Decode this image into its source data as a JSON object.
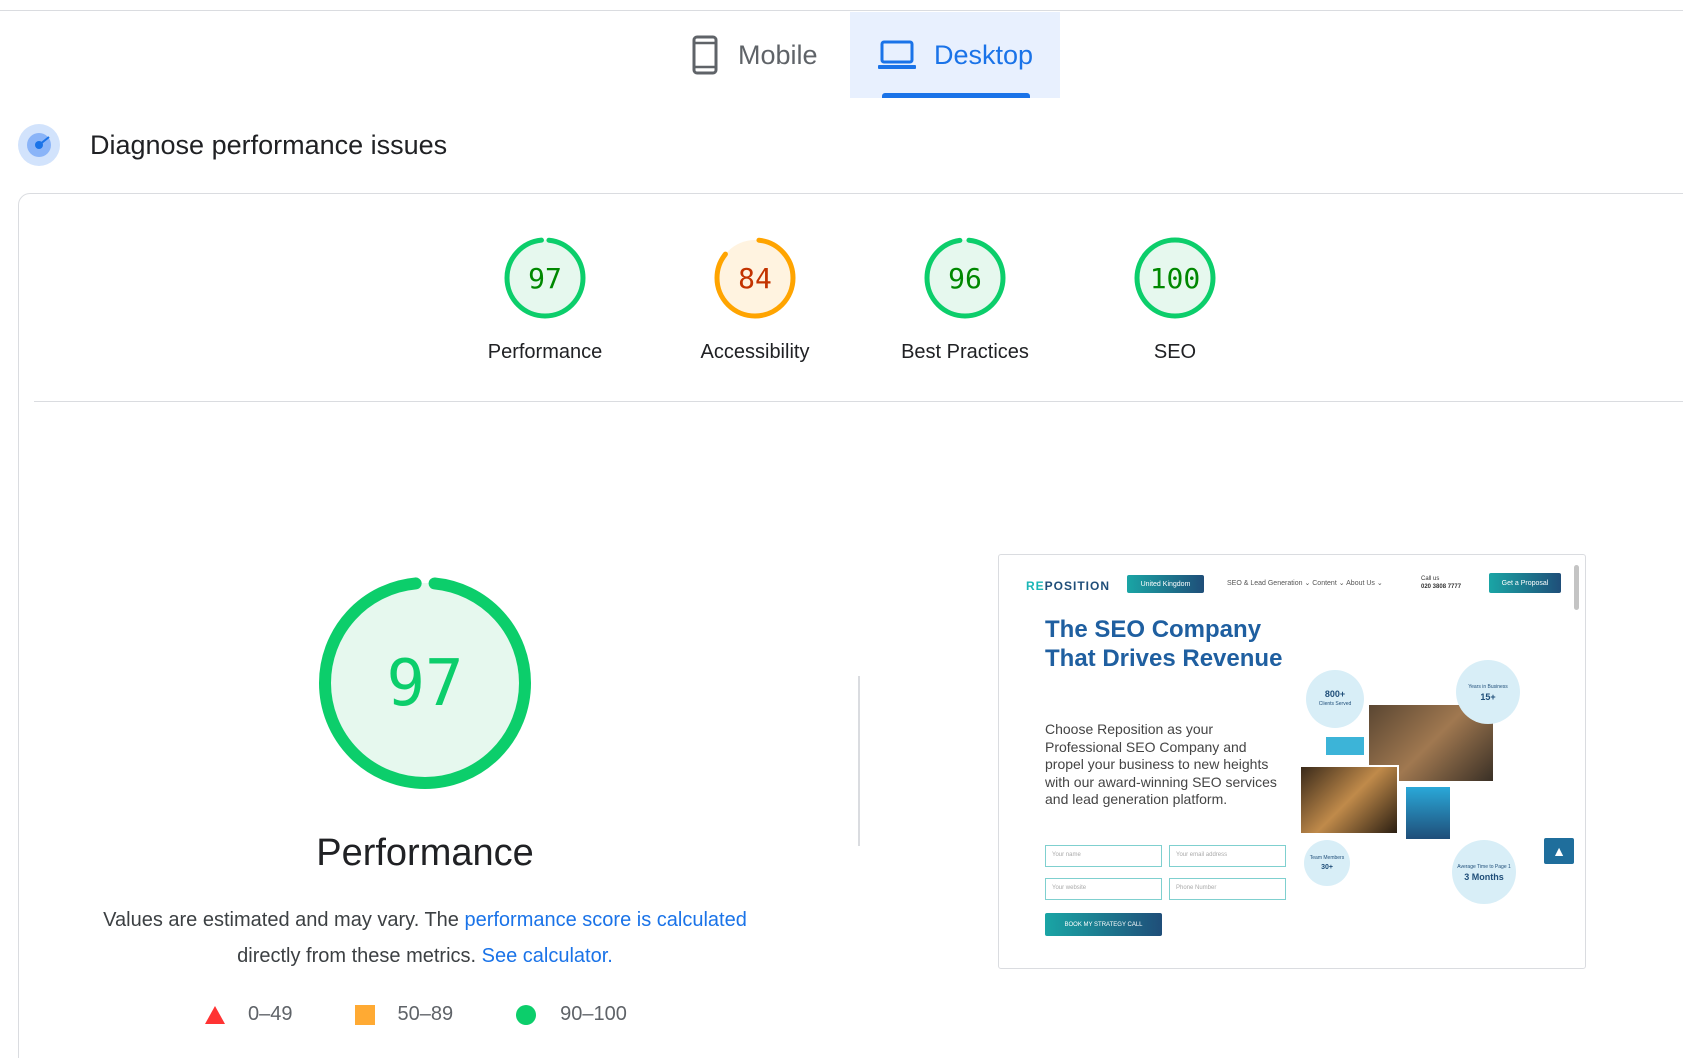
{
  "tabs": {
    "mobile": "Mobile",
    "desktop": "Desktop",
    "active": "desktop"
  },
  "section": {
    "title": "Diagnose performance issues"
  },
  "scores": [
    {
      "label": "Performance",
      "value": "97",
      "status": "pass"
    },
    {
      "label": "Accessibility",
      "value": "84",
      "status": "average"
    },
    {
      "label": "Best Practices",
      "value": "96",
      "status": "pass"
    },
    {
      "label": "SEO",
      "value": "100",
      "status": "pass"
    }
  ],
  "performance": {
    "score": "97",
    "title": "Performance",
    "desc_text_1": "Values are estimated and may vary. The ",
    "desc_link_1": "performance score is calculated",
    "desc_text_2": "directly from these metrics. ",
    "desc_link_2": "See calculator."
  },
  "legend": [
    {
      "range": "0–49",
      "shape": "triangle",
      "color": "#ff3333"
    },
    {
      "range": "50–89",
      "shape": "square",
      "color": "#ffaa33"
    },
    {
      "range": "90–100",
      "shape": "circle",
      "color": "#0cce6b"
    }
  ],
  "colors": {
    "pass": "#0cce6b",
    "pass_bg": "#e6f8ee",
    "pass_text": "#008800",
    "average": "#ffa400",
    "average_bg": "#fff3e0",
    "average_text": "#c33300",
    "accent": "#1a73e8"
  },
  "screenshot": {
    "logo_a": "RE",
    "logo_b": "POSITION",
    "region": "United Kingdom",
    "nav": "SEO & Lead Generation ⌄   Content ⌄   About Us ⌄",
    "call_label": "Call us",
    "phone": "020 3808 7777",
    "cta": "Get a Proposal",
    "headline": "The SEO Company That Drives Revenue",
    "body": "Choose Reposition as your Professional SEO Company and propel your business to new heights with our award-winning SEO services and lead generation platform.",
    "fields": [
      "Your name",
      "Your email address",
      "Your website",
      "Phone Number"
    ],
    "button": "BOOK MY STRATEGY CALL",
    "stat_clients": "800+",
    "stat_clients_label": "Clients Served",
    "stat_years_label": "Years in Business",
    "stat_years": "15+",
    "stat_team_label": "Team Members",
    "stat_team": "30+",
    "stat_time_label": "Average Time to Page 1",
    "stat_time": "3 Months"
  }
}
